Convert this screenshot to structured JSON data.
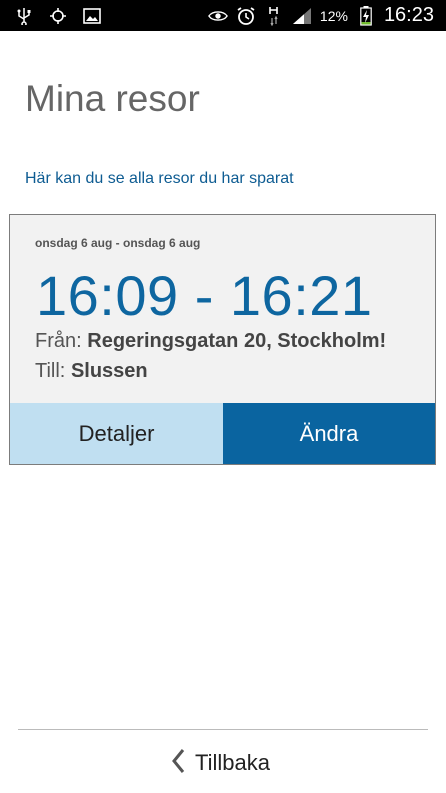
{
  "status_bar": {
    "icons_left": [
      "usb-icon",
      "gps-icon",
      "gallery-icon"
    ],
    "icons_right": [
      "eye-icon",
      "alarm-icon",
      "data-h-icon",
      "signal-icon"
    ],
    "battery": "12%",
    "time": "16:23"
  },
  "page": {
    "title": "Mina resor",
    "subtitle": "Här kan du se alla resor du har sparat"
  },
  "trip": {
    "dates": "onsdag 6 aug - onsdag 6 aug",
    "times": "16:09 - 16:21",
    "from_label": "Från:",
    "from_value": "Regeringsgatan 20, Stockholm!",
    "to_label": "Till:",
    "to_value": "Slussen",
    "details_button": "Detaljer",
    "change_button": "Ändra"
  },
  "footer": {
    "back_label": "Tillbaka"
  },
  "colors": {
    "accent": "#0a64a0",
    "accent_light": "#c0dff1",
    "link": "#0e5c92"
  }
}
